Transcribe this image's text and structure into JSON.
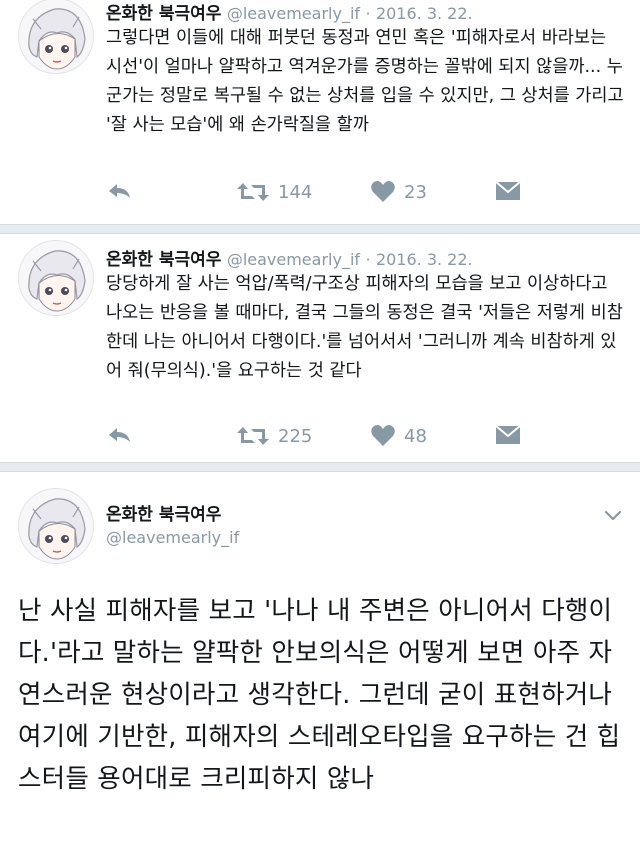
{
  "tweets": [
    {
      "name": "온화한 북극여우",
      "handle": "@leavemearly_if",
      "sep": "·",
      "date": "2016. 3. 22.",
      "text": "그렇다면 이들에 대해 퍼붓던 동정과 연민 혹은 '피해자로서 바라보는 시선'이 얼마나 얄팍하고 역겨운가를 증명하는 꼴밖에 되지 않을까... 누군가는 정말로 복구될 수 없는 상처를 입을 수 있지만, 그 상처를 가리고 '잘 사는 모습'에 왜 손가락질을 할까",
      "retweets": "144",
      "likes": "23"
    },
    {
      "name": "온화한 북극여우",
      "handle": "@leavemearly_if",
      "sep": "·",
      "date": "2016. 3. 22.",
      "text": "당당하게 잘 사는 억압/폭력/구조상 피해자의 모습을 보고 이상하다고 나오는 반응을 볼 때마다, 결국 그들의 동정은 결국 '저들은 저렇게 비참한데 나는 아니어서 다행이다.'를 넘어서서 '그러니까 계속 비참하게 있어 줘(무의식).'을 요구하는 것 같다",
      "retweets": "225",
      "likes": "48"
    },
    {
      "name": "온화한 북극여우",
      "handle": "@leavemearly_if",
      "text": "난 사실 피해자를 보고 '나나 내 주변은 아니어서 다행이다.'라고 말하는 얄팍한 안보의식은 어떻게 보면 아주 자연스러운 현상이라고 생각한다. 그런데 굳이 표현하거나 여기에 기반한, 피해자의 스테레오타입을 요구하는 건 힙스터들 용어대로 크리피하지 않나"
    }
  ],
  "icons": {
    "reply": "reply-icon",
    "retweet": "retweet-icon",
    "like": "heart-icon",
    "dm": "envelope-icon",
    "chevron": "chevron-down-icon",
    "avatar": "avatar"
  },
  "colors": {
    "icon_gray": "#8899a6",
    "separator": "#e6ecf0",
    "text": "#14171a"
  }
}
